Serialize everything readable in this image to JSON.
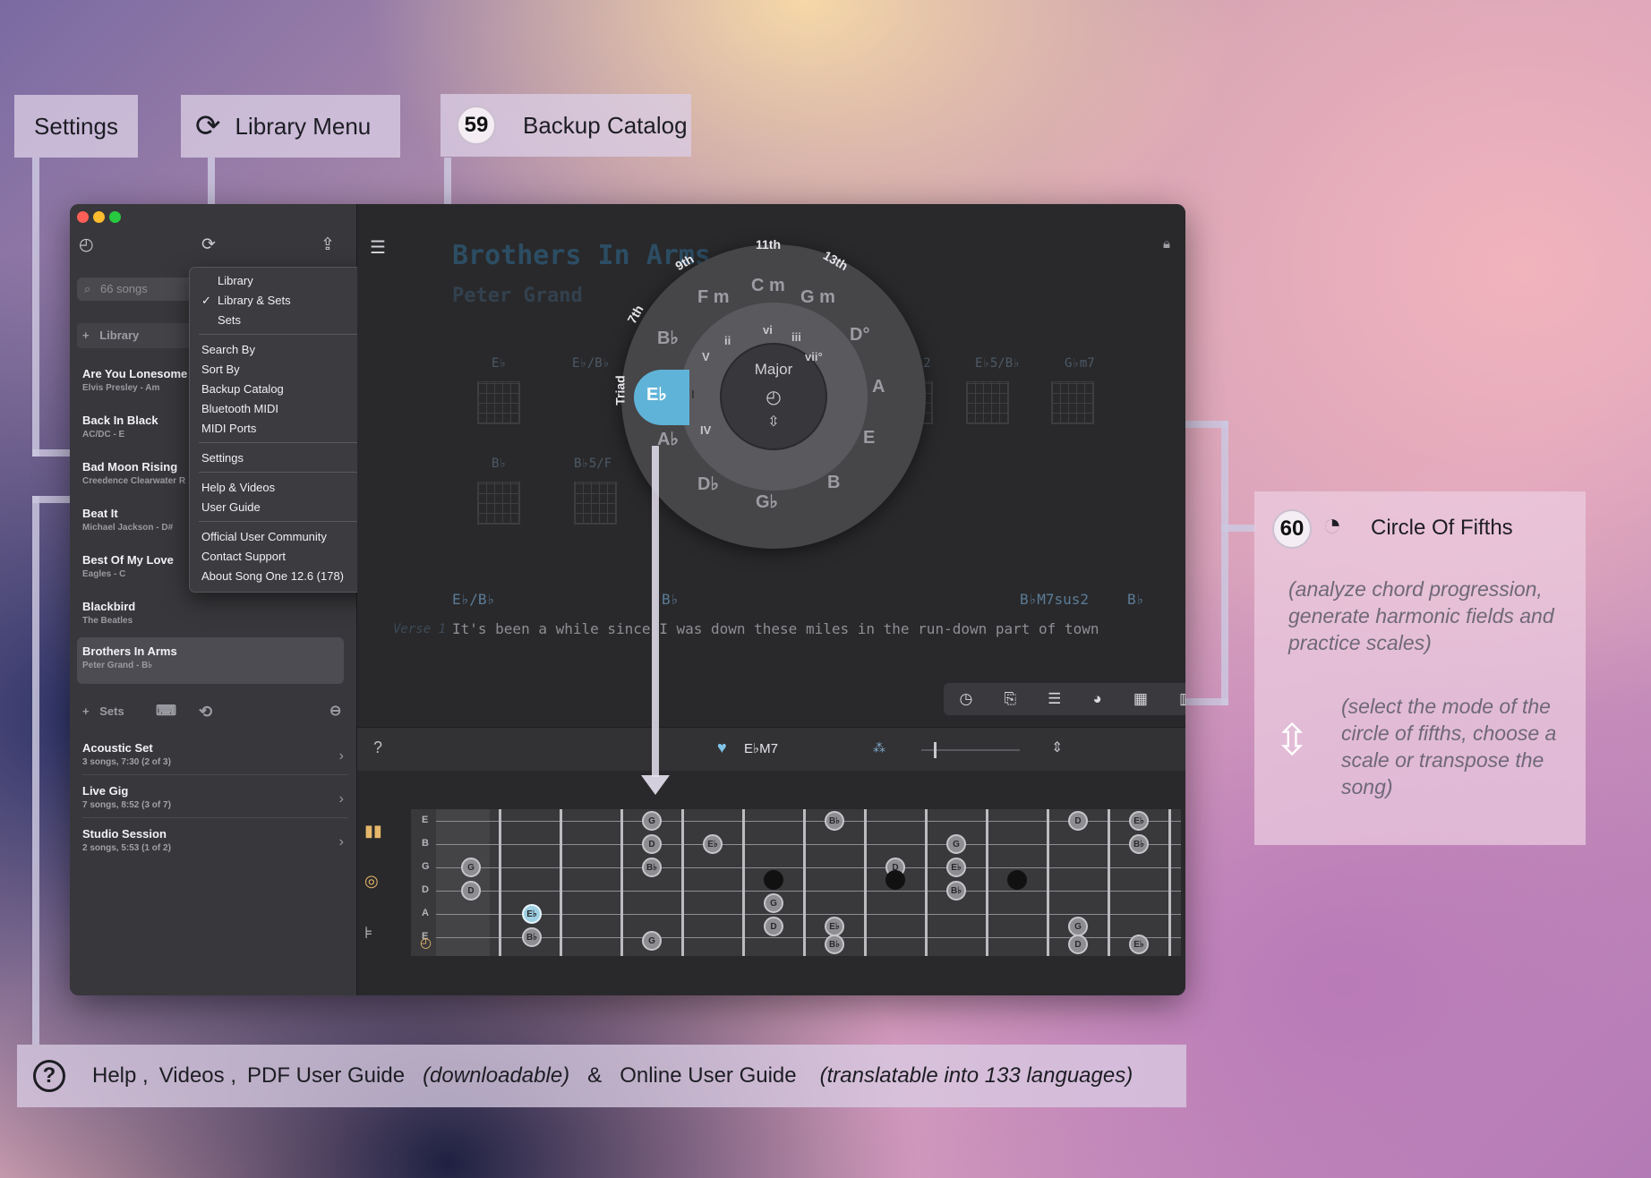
{
  "callouts": {
    "settings": "Settings",
    "library_menu": "Library Menu",
    "backup_number": "59",
    "backup_catalog": "Backup Catalog",
    "cof_number": "60",
    "cof_title": "Circle Of Fifths",
    "cof_desc": "(analyze chord progression, generate harmonic fields and practice scales)",
    "cof_mode_desc": "(select the mode of the circle of fifths, choose a scale or transpose the song)"
  },
  "help_bar": {
    "help": "Help ,",
    "videos": "Videos ,",
    "pdf": "PDF User Guide",
    "downloadable": "(downloadable)",
    "amp": "&",
    "online": "Online User Guide",
    "translatable": "(translatable into 133 languages)"
  },
  "sidebar": {
    "search_placeholder": "66 songs",
    "library_header": "Library",
    "songs": [
      {
        "title": "Are You Lonesome",
        "sub": "Elvis Presley - Am"
      },
      {
        "title": "Back In Black",
        "sub": "AC/DC - E"
      },
      {
        "title": "Bad Moon Rising",
        "sub": "Creedence Clearwater R"
      },
      {
        "title": "Beat It",
        "sub": "Michael Jackson - D#"
      },
      {
        "title": "Best Of My Love",
        "sub": "Eagles - C"
      },
      {
        "title": "Blackbird",
        "sub": "The Beatles"
      },
      {
        "title": "Brothers In Arms",
        "sub": "Peter Grand - B♭"
      }
    ],
    "sets_header": "Sets",
    "sets": [
      {
        "title": "Acoustic Set",
        "sub": "3 songs, 7:30 (2 of 3)"
      },
      {
        "title": "Live Gig",
        "sub": "7 songs, 8:52 (3 of 7)"
      },
      {
        "title": "Studio Session",
        "sub": "2 songs, 5:53 (1 of 2)"
      }
    ]
  },
  "menu": {
    "items": [
      "Library",
      "Library & Sets",
      "Sets",
      "Search By",
      "Sort By",
      "Backup Catalog",
      "Bluetooth MIDI",
      "MIDI Ports",
      "Settings",
      "Help & Videos",
      "User Guide",
      "Official User Community",
      "Contact Support",
      "About Song One 12.6 (178)"
    ]
  },
  "song": {
    "title": "Brothers In Arms",
    "artist": "Peter Grand",
    "verse_label": "Verse 1",
    "lyric": "It's been a while since I was down these miles in the run-down part of town",
    "lyric_chords": [
      "E♭/B♭",
      "B♭",
      "B♭M7sus2",
      "B♭"
    ],
    "diagram_chords": [
      "E♭",
      "E♭/B♭",
      "B♭sus2",
      "E♭5/B♭",
      "G♭m7",
      "B♭",
      "B♭5/F"
    ],
    "current_chord": "E♭M7"
  },
  "circle": {
    "outer_labels": [
      "C m",
      "G m",
      "D°",
      "A",
      "E",
      "B",
      "G♭",
      "D♭",
      "A♭",
      "E♭",
      "B♭",
      "F m"
    ],
    "roman": [
      "vi",
      "iii",
      "vii°",
      "I",
      "IV",
      "V",
      "ii"
    ],
    "top_labels": [
      "9th",
      "11th",
      "13th",
      "7th",
      "Triad"
    ],
    "mode": "Major"
  },
  "fretboard": {
    "strings": [
      "E",
      "B",
      "G",
      "D",
      "A",
      "E"
    ]
  }
}
